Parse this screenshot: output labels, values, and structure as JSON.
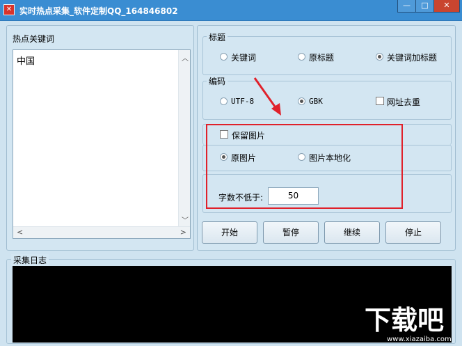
{
  "window": {
    "title": "实时热点采集_软件定制QQ_164846802",
    "icon_name": "app-logo-icon",
    "controls": {
      "minimize": "—",
      "maximize": "□",
      "close": "✕"
    }
  },
  "keywords_panel": {
    "label": "热点关键词",
    "items": [
      "中国"
    ]
  },
  "title_group": {
    "label": "标题",
    "options": [
      "关键词",
      "原标题",
      "关键词加标题"
    ],
    "selected": 2
  },
  "encoding_group": {
    "label": "编码",
    "options": [
      "UTF-8",
      "GBK"
    ],
    "selected": 1,
    "dedupe_label": "网址去重",
    "dedupe_checked": false
  },
  "image_group": {
    "keep_images_label": "保留图片",
    "keep_images_checked": false,
    "options": [
      "原图片",
      "图片本地化"
    ],
    "selected": 0
  },
  "min_chars": {
    "label": "字数不低于:",
    "value": "50"
  },
  "buttons": {
    "start": "开始",
    "pause": "暂停",
    "resume": "继续",
    "stop": "停止"
  },
  "log_panel": {
    "label": "采集日志"
  },
  "watermark": {
    "text": "下载吧",
    "url": "www.xiazaiba.com"
  },
  "colors": {
    "titlebar": "#3a8dd2",
    "highlight": "#e0212b",
    "log_bg": "#000000"
  }
}
